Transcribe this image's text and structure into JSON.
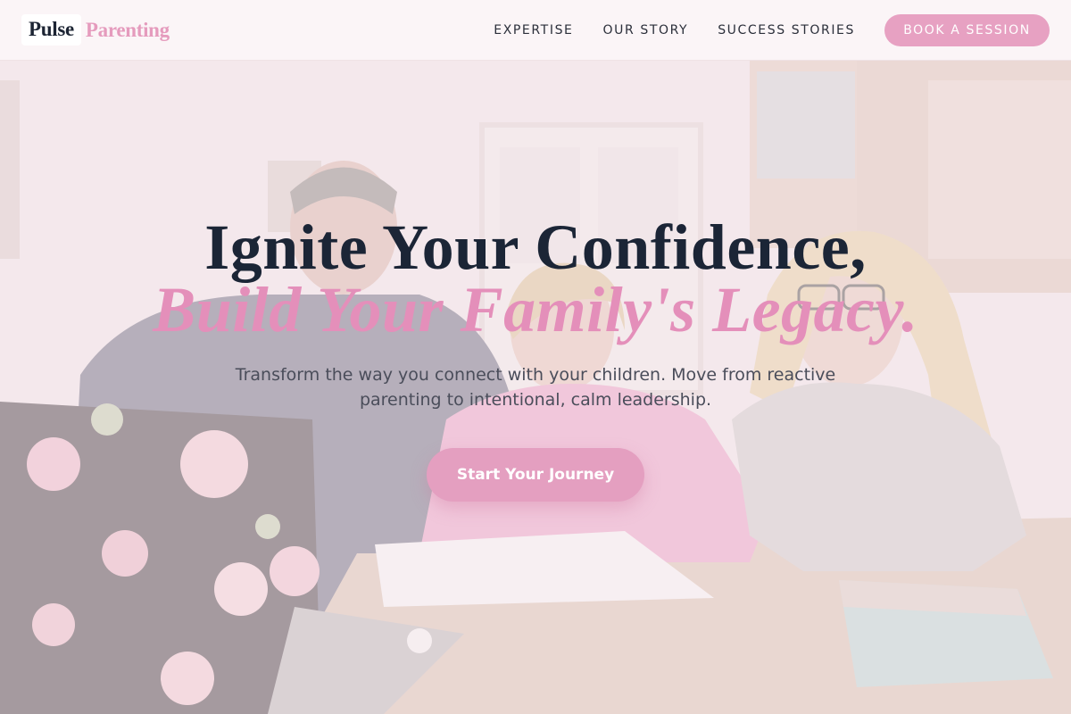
{
  "brand": {
    "primary": "Pulse",
    "accent": "Parenting"
  },
  "nav": {
    "links": [
      "EXPERTISE",
      "OUR STORY",
      "SUCCESS STORIES"
    ],
    "cta_label": "BOOK A SESSION"
  },
  "hero": {
    "headline_line1": "Ignite Your Confidence,",
    "headline_line2": "Build Your Family's Legacy.",
    "subtext": "Transform the way you connect with your children. Move from reactive parenting to intentional, calm leadership.",
    "cta_label": "Start Your Journey"
  },
  "colors": {
    "accent_pink": "#e59bbd",
    "navy_text": "#1b2536",
    "nav_background": "#fcf6f7"
  }
}
